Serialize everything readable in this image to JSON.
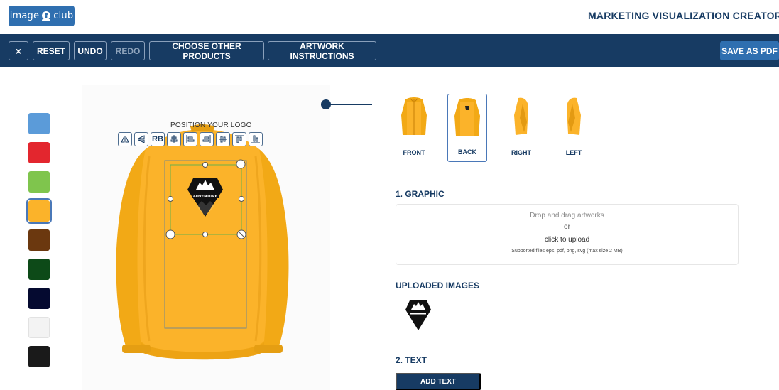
{
  "header": {
    "logo_text_left": "image",
    "logo_text_right": "club",
    "title": "MARKETING VISUALIZATION CREATOR"
  },
  "toolbar": {
    "close_label": "×",
    "reset_label": "RESET",
    "undo_label": "UNDO",
    "redo_label": "REDO",
    "choose_label": "CHOOSE OTHER PRODUCTS",
    "artwork_label": "ARTWORK INSTRUCTIONS",
    "save_pdf_label": "SAVE AS PDF"
  },
  "colors": {
    "brand_dark": "#173b63",
    "brand_blue": "#2f6fb0",
    "swatches": [
      "#5b9bd9",
      "#e3262e",
      "#7fc54d",
      "#fbb32a",
      "#6b380f",
      "#0d4a18",
      "#050a30",
      "#f3f3f3",
      "#1a1a1a"
    ],
    "selected_swatch": "#fbb32a"
  },
  "editor": {
    "position_label": "POSITION YOUR LOGO",
    "tools": [
      "flip-horizontal-icon",
      "flip-vertical-icon",
      "RB",
      "align-center-horizontal-icon",
      "align-left-icon",
      "align-right-icon",
      "align-middle-vertical-icon",
      "align-top-icon",
      "align-bottom-icon"
    ],
    "logo_text": "ADVENTURE"
  },
  "views": [
    {
      "label": "FRONT"
    },
    {
      "label": "BACK"
    },
    {
      "label": "RIGHT"
    },
    {
      "label": "LEFT"
    }
  ],
  "graphic": {
    "heading": "1. GRAPHIC",
    "drop_text": "Drop and drag artworks",
    "or_text": "or",
    "upload_text": "click to upload",
    "supported_text": "Supported files eps, pdf, png, svg (max size 2 MB)"
  },
  "uploaded": {
    "heading": "UPLOADED IMAGES"
  },
  "text_section": {
    "heading": "2. TEXT",
    "add_text_label": "ADD TEXT"
  }
}
